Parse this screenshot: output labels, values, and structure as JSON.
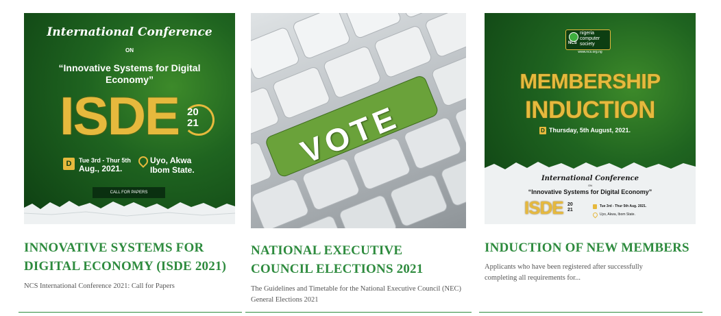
{
  "cards": [
    {
      "title": "INNOVATIVE SYSTEMS FOR DIGITAL ECONOMY (ISDE 2021)",
      "excerpt": "NCS International Conference 2021: Call for Papers",
      "poster": {
        "script_heading": "International Conference",
        "on": "ON",
        "theme": "“Innovative Systems for Digital Economy”",
        "acronym": "ISDE",
        "year_top": "20",
        "year_bottom": "21",
        "date_line1": "Tue 3rd - Thur 5th",
        "date_line2": "Aug., 2021.",
        "place_line1": "Uyo, Akwa",
        "place_line2": "Ibom State.",
        "cta": "CALL FOR PAPERS"
      }
    },
    {
      "title": "NATIONAL EXECUTIVE COUNCIL ELECTIONS 2021",
      "excerpt": "The Guidelines and Timetable for the National Executive Council (NEC) General Elections 2021",
      "poster": {
        "key_label": "VOTE"
      }
    },
    {
      "title": "INDUCTION OF NEW MEMBERS",
      "excerpt": "Applicants who have been registered after successfully completing all requirements for...",
      "poster": {
        "logo_text": "NCS",
        "logo_name_1": "nigeria",
        "logo_name_2": "computer",
        "logo_name_3": "society",
        "logo_url": "www.ncs.org.ng",
        "headline_1": "MEMBERSHIP",
        "headline_2": "INDUCTION",
        "date": "Thursday, 5th August, 2021.",
        "mini_script": "International Conference",
        "mini_on": "ON",
        "mini_theme": "“Innovative Systems for Digital Economy”",
        "mini_acronym": "ISDE",
        "mini_year_top": "20",
        "mini_year_bottom": "21",
        "mini_date": "Tue 3rd - Thur 5th Aug. 2021.",
        "mini_place": "Uyo, Akwa, Ibom State."
      }
    }
  ],
  "colors": {
    "title": "#2e8b3e",
    "rule": "#2e8b3e",
    "gold": "#e6b93d"
  }
}
